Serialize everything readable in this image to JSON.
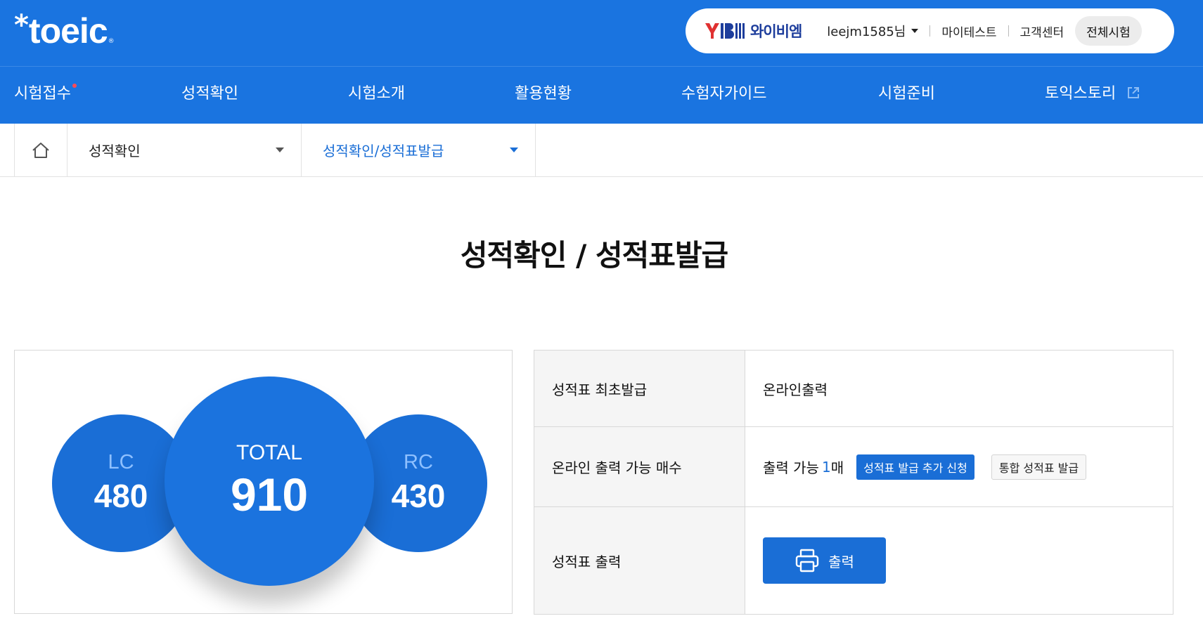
{
  "header": {
    "logo_text": "toeic",
    "logo_mark": "*",
    "logo_reg": "®",
    "util": {
      "ybm_name": "와이비엠",
      "user": "leejm1585님",
      "mytest": "마이테스트",
      "support": "고객센터",
      "all_tests": "전체시험"
    },
    "nav": [
      {
        "label": "시험접수"
      },
      {
        "label": "성적확인"
      },
      {
        "label": "시험소개"
      },
      {
        "label": "활용현황"
      },
      {
        "label": "수험자가이드"
      },
      {
        "label": "시험준비"
      },
      {
        "label": "토익스토리"
      }
    ],
    "colors": {
      "primary": "#1a74e0",
      "badge_dot": "#ff4a57"
    }
  },
  "breadcrumb": {
    "level1": "성적확인",
    "level2": "성적확인/성적표발급"
  },
  "page": {
    "title": "성적확인 / 성적표발급"
  },
  "scores": {
    "lc": {
      "label": "LC",
      "value": "480"
    },
    "total": {
      "label": "TOTAL",
      "value": "910"
    },
    "rc": {
      "label": "RC",
      "value": "430"
    }
  },
  "info": {
    "row1": {
      "label": "성적표 최초발급",
      "value": "온라인출력"
    },
    "row2": {
      "label": "온라인 출력 가능 매수",
      "prefix": "출력 가능",
      "count": "1",
      "suffix": "매",
      "add_button": "성적표 발급 추가 신청",
      "integrated_button": "통합 성적표 발급"
    },
    "row3": {
      "label": "성적표 출력",
      "print_button": "출력"
    }
  }
}
